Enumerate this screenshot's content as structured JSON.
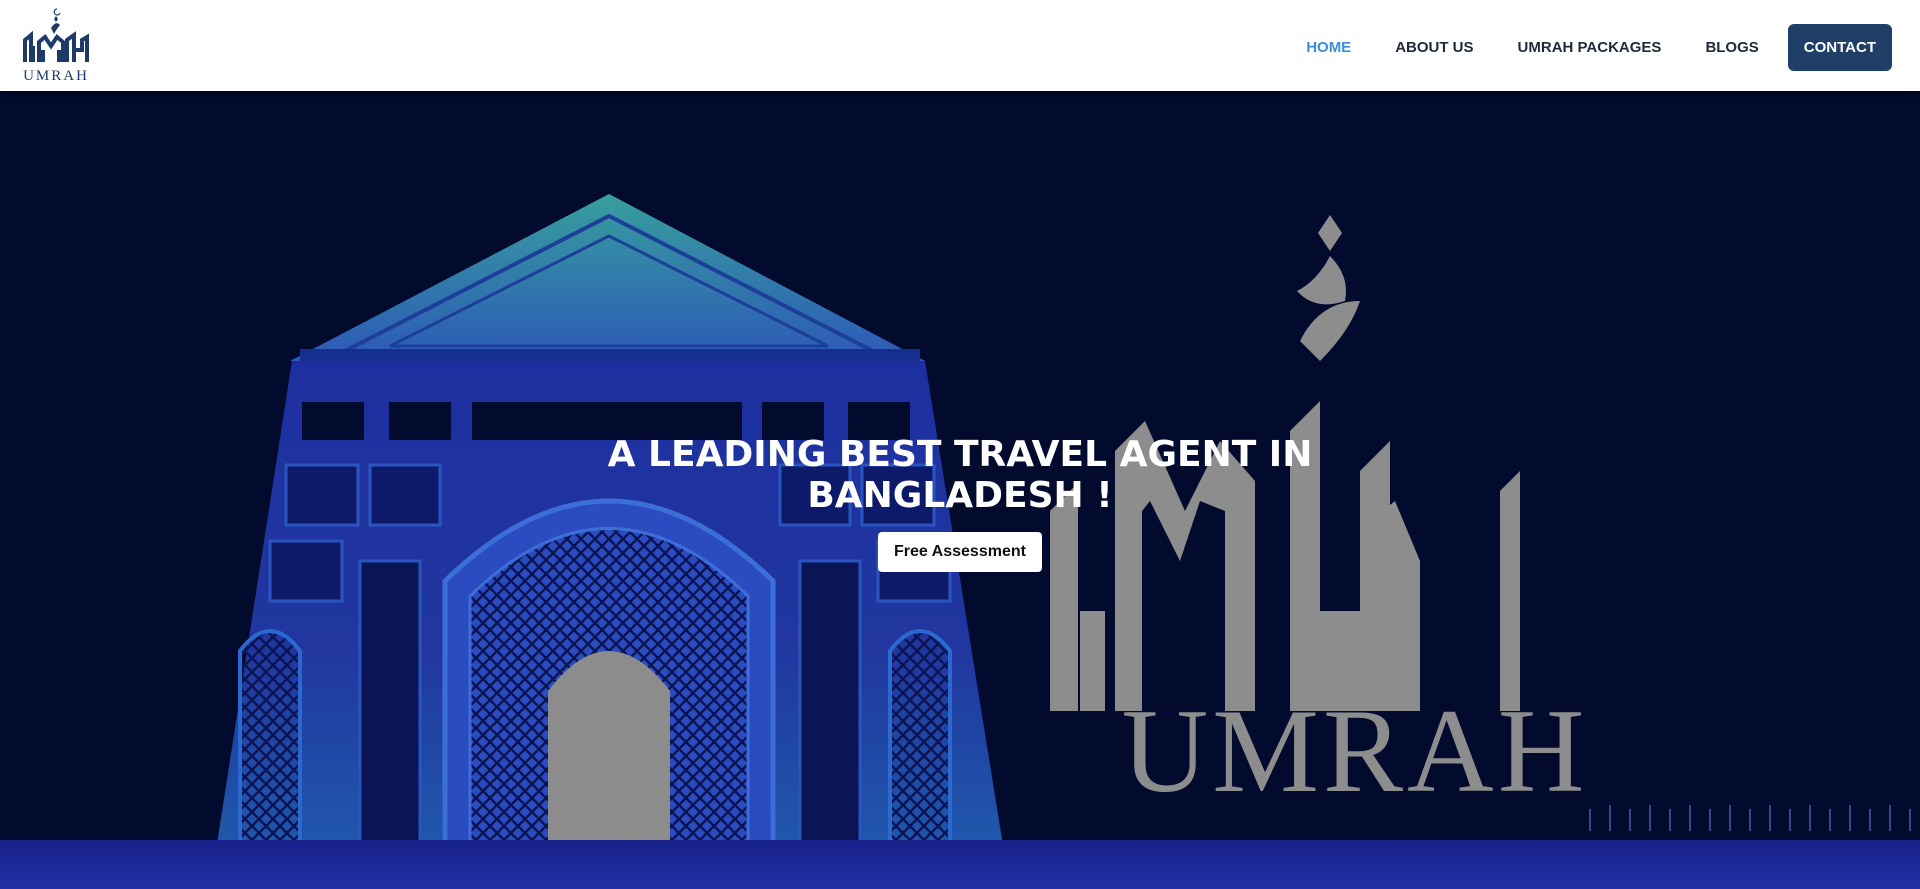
{
  "brand": {
    "logo_text": "UMRAH",
    "colors": {
      "navy": "#1f3f66",
      "active": "#3b8fd9",
      "text": "#1f2a3a",
      "hero_bg": "#020a2e"
    }
  },
  "nav": {
    "items": [
      {
        "label": "HOME",
        "active": true
      },
      {
        "label": "ABOUT US"
      },
      {
        "label": "UMRAH PACKAGES"
      },
      {
        "label": "BLOGS"
      }
    ],
    "contact_label": "CONTACT"
  },
  "hero": {
    "title_line1": "A LEADING BEST TRAVEL AGENT IN",
    "title_line2": "BANGLADESH !",
    "cta_label": "Free Assessment",
    "watermark_text": "UMRAH"
  }
}
